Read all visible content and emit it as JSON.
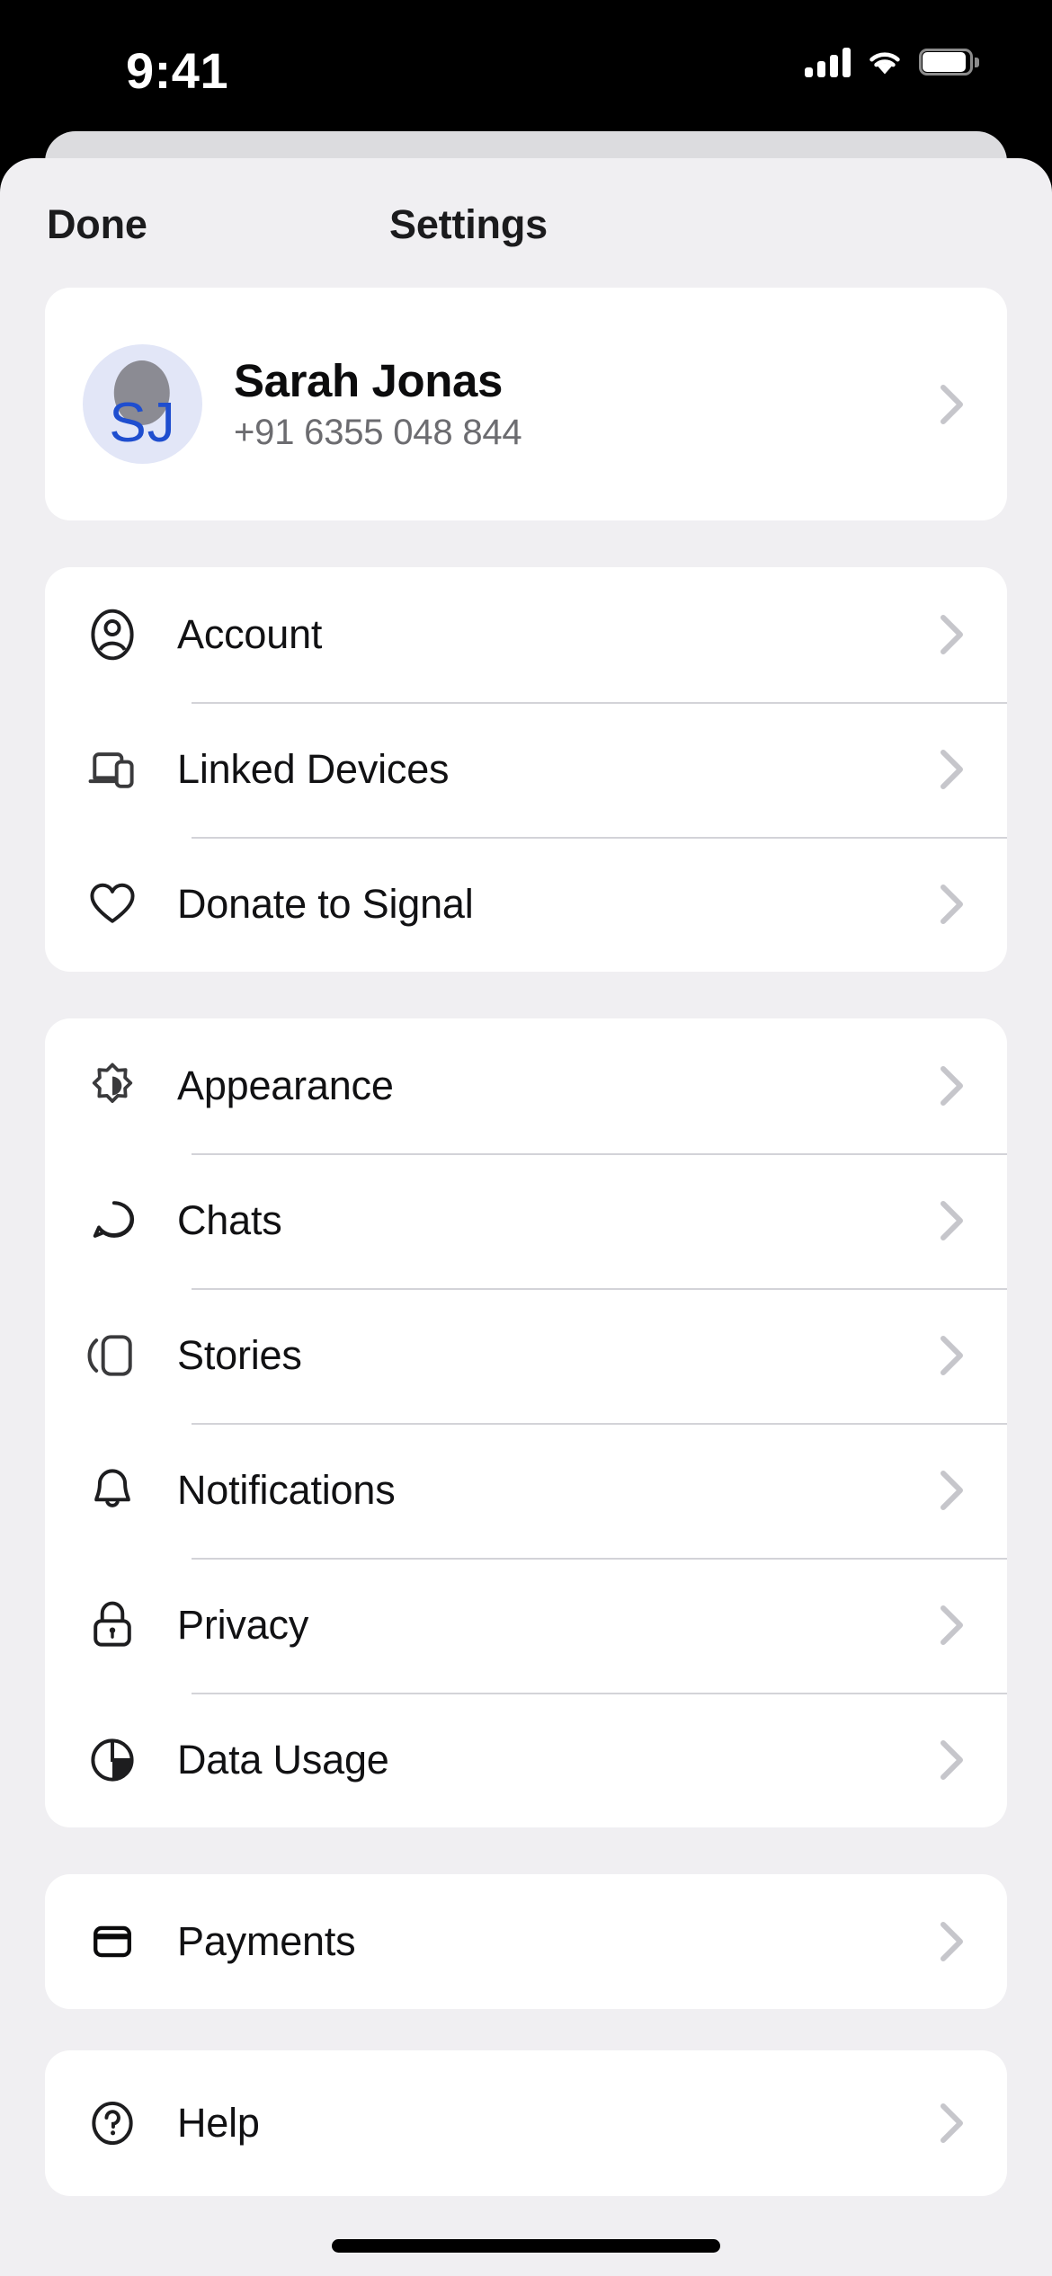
{
  "status_bar": {
    "time": "9:41",
    "cellular_icon": "cellular-signal-icon",
    "cellular_bars": 4,
    "wifi_icon": "wifi-icon",
    "battery_icon": "battery-full-icon",
    "battery_level": 100
  },
  "nav": {
    "done_label": "Done",
    "title": "Settings"
  },
  "profile": {
    "initials": "SJ",
    "name": "Sarah Jonas",
    "phone": "+91 6355 048 844",
    "avatar_bg": "#e2e6f7",
    "initials_color": "#1f4ecf",
    "chevron_icon": "chevron-right-icon"
  },
  "groups": [
    {
      "id": "account-group",
      "items": [
        {
          "label": "Account",
          "icon": "account-icon"
        },
        {
          "label": "Linked Devices",
          "icon": "linked-devices-icon"
        },
        {
          "label": "Donate to Signal",
          "icon": "heart-icon"
        }
      ]
    },
    {
      "id": "preferences-group",
      "items": [
        {
          "label": "Appearance",
          "icon": "appearance-icon"
        },
        {
          "label": "Chats",
          "icon": "chat-bubble-icon"
        },
        {
          "label": "Stories",
          "icon": "stories-icon"
        },
        {
          "label": "Notifications",
          "icon": "bell-icon"
        },
        {
          "label": "Privacy",
          "icon": "lock-icon"
        },
        {
          "label": "Data Usage",
          "icon": "pie-chart-icon"
        }
      ]
    },
    {
      "id": "payments-group",
      "items": [
        {
          "label": "Payments",
          "icon": "credit-card-icon"
        }
      ]
    },
    {
      "id": "help-group",
      "items": [
        {
          "label": "Help",
          "icon": "question-circle-icon"
        }
      ]
    }
  ],
  "colors": {
    "sheet_background": "#f0eff2",
    "card_background": "#ffffff",
    "separator": "#d3d3d8",
    "chevron": "#c6c6cb",
    "primary_text": "#111113",
    "secondary_text": "#6c6c70"
  },
  "home_indicator": "home-indicator"
}
